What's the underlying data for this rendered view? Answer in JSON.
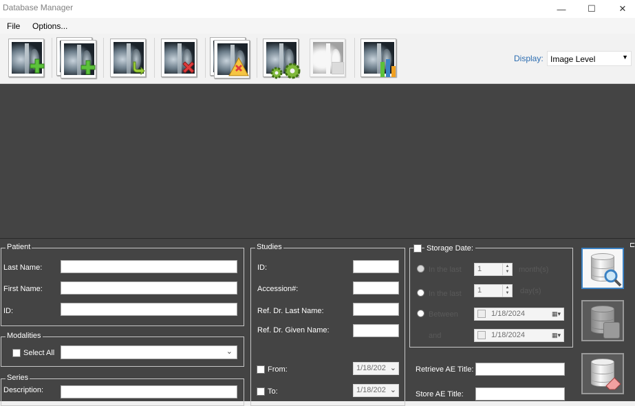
{
  "window": {
    "title": "Database Manager",
    "minimize": "—",
    "maximize": "☐",
    "close": "✕"
  },
  "menu": {
    "file": "File",
    "options": "Options..."
  },
  "toolbar": {
    "buttons": [
      {
        "name": "import-image-button",
        "icon": "xray-add-icon"
      },
      {
        "name": "import-series-button",
        "icon": "xray-stack-add-icon"
      },
      {
        "name": "refresh-button",
        "icon": "xray-refresh-icon"
      },
      {
        "name": "delete-image-button",
        "icon": "xray-delete-icon"
      },
      {
        "name": "delete-series-warning-button",
        "icon": "xray-stack-warning-icon"
      },
      {
        "name": "settings-button",
        "icon": "xray-gears-icon"
      },
      {
        "name": "disabled-tool-button",
        "icon": "xray-disabled-icon"
      },
      {
        "name": "statistics-button",
        "icon": "xray-chart-icon"
      }
    ],
    "display_label": "Display:",
    "display_value": "Image Level"
  },
  "patient": {
    "title": "Patient",
    "last_name_label": "Last Name:",
    "first_name_label": "First Name:",
    "id_label": "ID:",
    "last_name": "",
    "first_name": "",
    "id": ""
  },
  "modalities": {
    "title": "Modalities",
    "select_all": "Select All",
    "value": ""
  },
  "series": {
    "title": "Series",
    "description_label": "Description:",
    "description": ""
  },
  "studies": {
    "title": "Studies",
    "id_label": "ID:",
    "accession_label": "Accession#:",
    "ref_dr_last_label": "Ref. Dr. Last Name:",
    "ref_dr_given_label": "Ref. Dr. Given Name:",
    "from_label": "From:",
    "to_label": "To:",
    "from_date": "1/18/202",
    "to_date": "1/18/202"
  },
  "storage": {
    "title": "Storage Date:",
    "in_the_last_1": "In the last",
    "months_value": "1",
    "months_label": "month(s)",
    "in_the_last_2": "In the last",
    "days_value": "1",
    "days_label": "day(s)",
    "between_label": "Between",
    "and_label": "and",
    "between_date": "1/18/2024",
    "and_date": "1/18/2024"
  },
  "ae": {
    "retrieve_label": "Retrieve AE Title:",
    "store_label": "Store AE Title:",
    "retrieve": "",
    "store": ""
  },
  "colors": {
    "panel_bg": "#444444",
    "link_blue": "#2b6cb0",
    "active_border": "#3b82c4"
  }
}
